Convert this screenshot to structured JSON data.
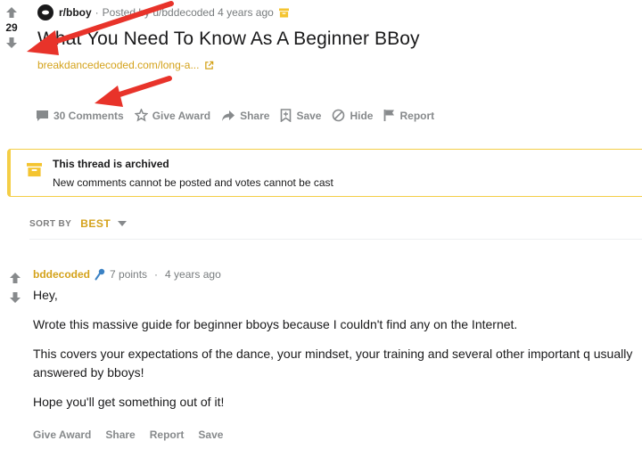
{
  "post": {
    "score": "29",
    "subreddit": "r/bboy",
    "posted_by": "Posted by u/bddecoded 4 years ago",
    "title": "What You Need To Know As A Beginner BBoy",
    "link_text": "breakdancedecoded.com/long-a...",
    "actions": [
      {
        "label": "30 Comments",
        "icon": "comment-icon"
      },
      {
        "label": "Give Award",
        "icon": "award-icon"
      },
      {
        "label": "Share",
        "icon": "share-icon"
      },
      {
        "label": "Save",
        "icon": "save-icon"
      },
      {
        "label": "Hide",
        "icon": "hide-icon"
      },
      {
        "label": "Report",
        "icon": "report-icon"
      }
    ]
  },
  "archived": {
    "title": "This thread is archived",
    "message": "New comments cannot be posted and votes cannot be cast"
  },
  "sort": {
    "label": "SORT BY",
    "value": "BEST"
  },
  "comment": {
    "author": "bddecoded",
    "points": "7 points",
    "age": "4 years ago",
    "paragraphs": [
      "Hey,",
      "Wrote this massive guide for beginner bboys because I couldn't find any on the Internet.",
      "This covers your expectations of the dance, your mindset, your training and several other important q usually answered by bboys!",
      "Hope you'll get something out of it!"
    ],
    "actions": [
      "Give Award",
      "Share",
      "Report",
      "Save"
    ]
  },
  "colors": {
    "accent": "#d4a21b",
    "archive_border": "#f4ce46",
    "annotation_arrow": "#e8332a",
    "muted": "#878a8c"
  }
}
